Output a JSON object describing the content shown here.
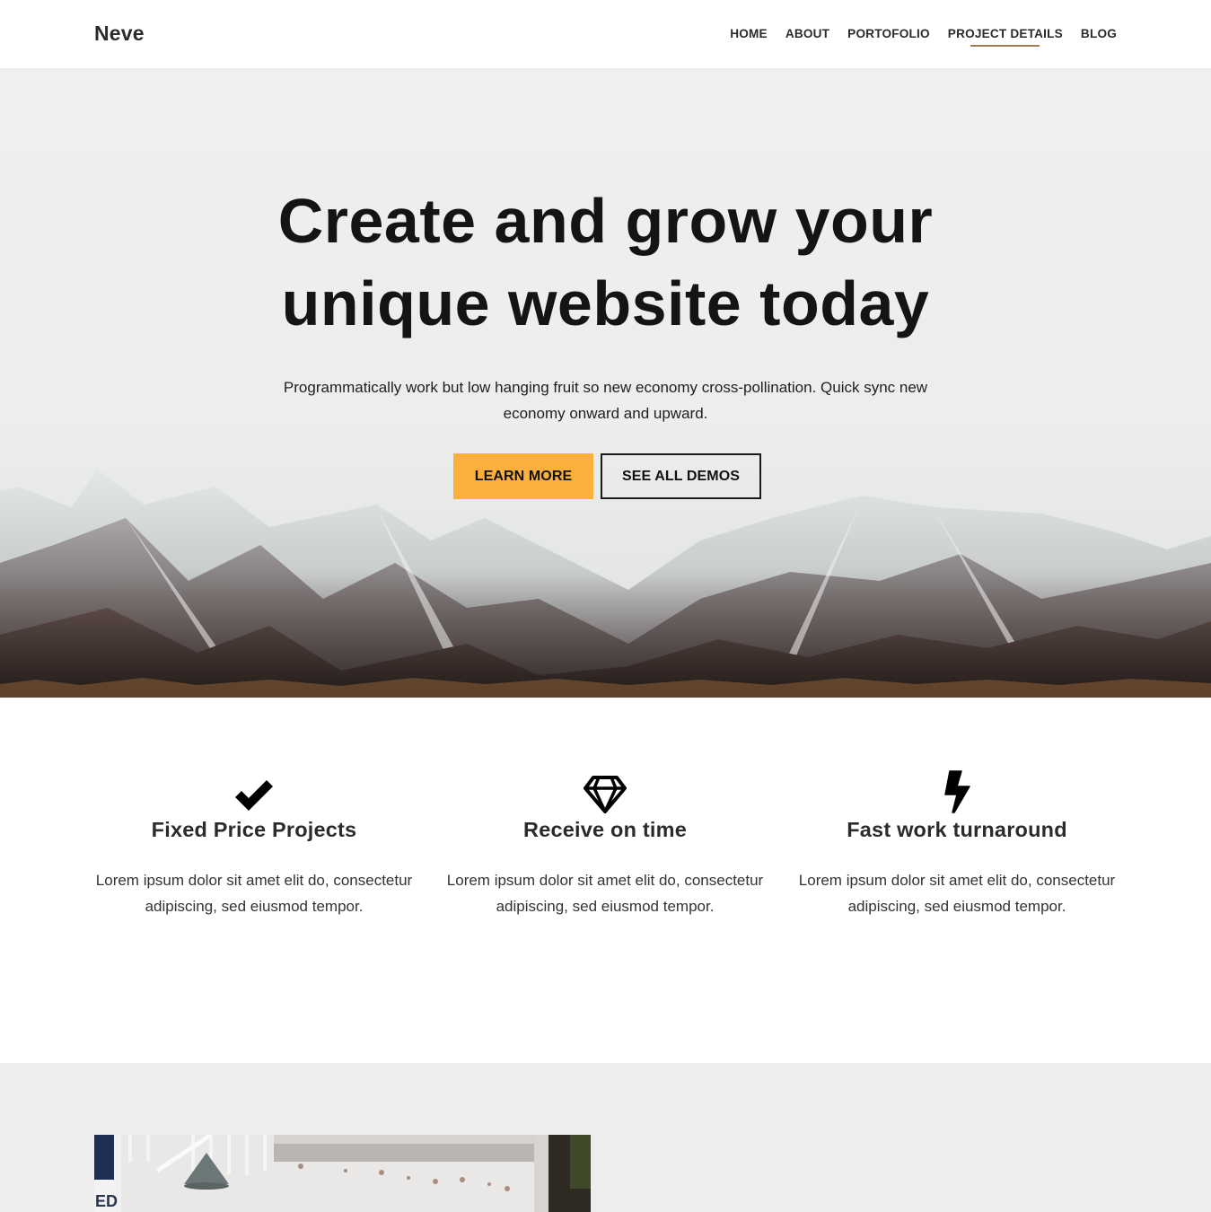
{
  "header": {
    "logo": "Neve",
    "nav": [
      {
        "label": "HOME",
        "active": false
      },
      {
        "label": "ABOUT",
        "active": false
      },
      {
        "label": "PORTOFOLIO",
        "active": false
      },
      {
        "label": "PROJECT DETAILS",
        "active": true
      },
      {
        "label": "BLOG",
        "active": false
      }
    ],
    "active_underline_color": "#a67c4e"
  },
  "hero": {
    "title_line1": "Create and grow your",
    "title_line2": "unique website today",
    "subtitle": "Programmatically work but low hanging fruit so new economy cross-pollination. Quick sync new economy onward and upward.",
    "primary_button": "LEARN MORE",
    "secondary_button": "SEE ALL DEMOS",
    "accent_color": "#fcb03c",
    "background_image": "snow-capped-mountains"
  },
  "features": [
    {
      "icon": "checkmark-icon",
      "title": "Fixed Price Projects",
      "text": "Lorem ipsum dolor sit amet elit do, consectetur adipiscing, sed eiusmod tempor."
    },
    {
      "icon": "diamond-icon",
      "title": "Receive on time",
      "text": "Lorem ipsum dolor sit amet elit do, consectetur adipiscing, sed eiusmod tempor."
    },
    {
      "icon": "lightning-bolt-icon",
      "title": "Fast work turnaround",
      "text": "Lorem ipsum dolor sit amet elit do, consectetur adipiscing, sed eiusmod tempor."
    }
  ],
  "bottom_section": {
    "image": "porch-with-leaves-photo",
    "background_color": "#ededed"
  }
}
